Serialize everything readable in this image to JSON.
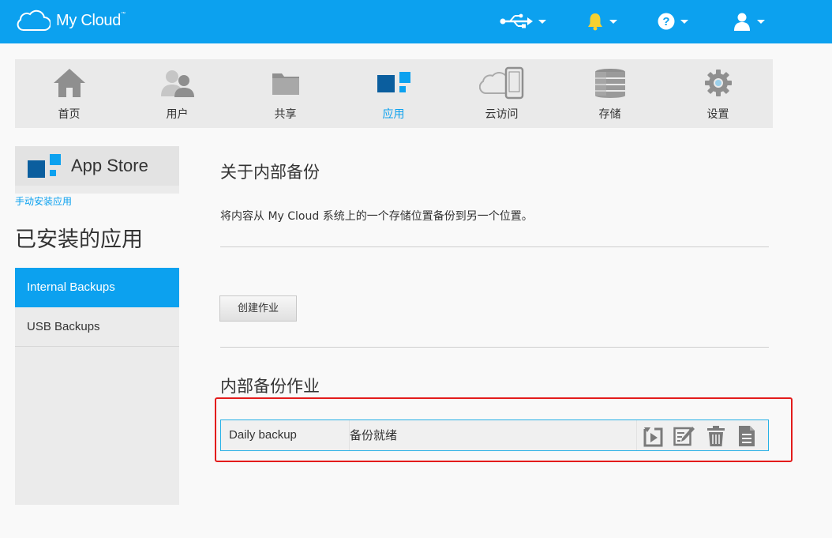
{
  "header": {
    "logo_text": "My Cloud",
    "logo_tm": "™",
    "icons": [
      "usb-icon",
      "bell-icon",
      "help-icon",
      "user-icon"
    ],
    "bell_color": "#f5d130"
  },
  "nav": {
    "items": [
      {
        "label": "首页",
        "icon": "home-icon"
      },
      {
        "label": "用户",
        "icon": "users-icon"
      },
      {
        "label": "共享",
        "icon": "folder-icon"
      },
      {
        "label": "应用",
        "icon": "apps-icon"
      },
      {
        "label": "云访问",
        "icon": "cloud-device-icon"
      },
      {
        "label": "存储",
        "icon": "storage-icon"
      },
      {
        "label": "设置",
        "icon": "gear-icon"
      }
    ],
    "active": "应用"
  },
  "sidebar": {
    "app_store_label": "App Store",
    "manual_install_link": "手动安装应用",
    "installed_title": "已安装的应用",
    "apps": [
      {
        "label": "Internal Backups",
        "active": true
      },
      {
        "label": "USB Backups",
        "active": false
      }
    ]
  },
  "main": {
    "title": "关于内部备份",
    "description": "将内容从 My Cloud 系统上的一个存储位置备份到另一个位置。",
    "create_button": "创建作业",
    "jobs_title": "内部备份作业",
    "jobs": [
      {
        "name": "Daily backup",
        "status": "备份就绪",
        "actions": [
          "restore-icon",
          "edit-icon",
          "delete-icon",
          "details-icon"
        ]
      }
    ]
  },
  "colors": {
    "brand": "#0ca1ef",
    "highlight": "#e31c1c",
    "app_dark_blue": "#0b5e9e",
    "app_light_blue": "#0ca1ef"
  }
}
